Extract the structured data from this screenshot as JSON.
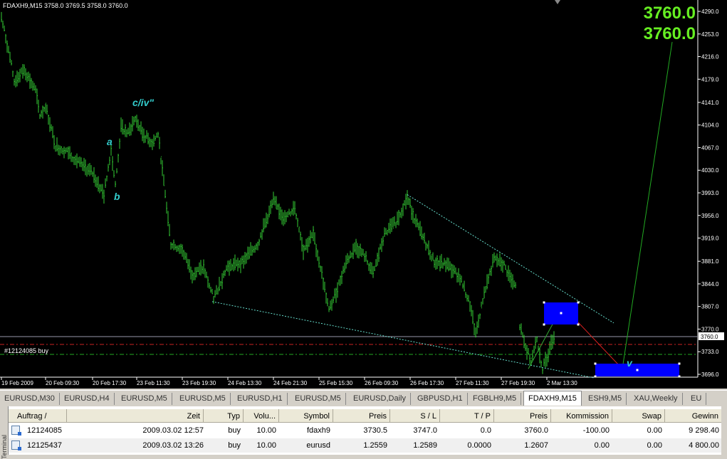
{
  "chart": {
    "title": "FDAXH9,M15  3758.0 3769.5 3758.0 3760.0",
    "big_price_1": "3760.0",
    "big_price_2": "3760.0",
    "current_price_label": "3760.0",
    "order_label": "#12124085 buy",
    "wave_labels": [
      "c/iv\"",
      "a",
      "b",
      "v"
    ],
    "price_axis": [
      "4290.0",
      "4253.0",
      "4216.0",
      "4179.0",
      "4141.0",
      "4104.0",
      "4067.0",
      "4030.0",
      "3993.0",
      "3956.0",
      "3919.0",
      "3881.0",
      "3844.0",
      "3807.0",
      "3770.0",
      "3733.0",
      "3696.0"
    ],
    "time_axis": [
      "19 Feb 2009",
      "20 Feb 09:30",
      "20 Feb 17:30",
      "23 Feb 11:30",
      "23 Feb 19:30",
      "24 Feb 13:30",
      "24 Feb 21:30",
      "25 Feb 15:30",
      "26 Feb 09:30",
      "26 Feb 17:30",
      "27 Feb 11:30",
      "27 Feb 19:30",
      "2 Mar 13:30"
    ],
    "colors": {
      "bars": "#33cc33",
      "label": "#33cccc",
      "big_price": "#66ee22",
      "rect": "#0000ff"
    }
  },
  "tabs": [
    "EURUSD,M30",
    "EURUSD,H4",
    "EURUSD,M5",
    "EURUSD,M5",
    "EURUSD,H1",
    "EURUSD,M5",
    "EURUSD,Daily",
    "GBPUSD,H1",
    "FGBLH9,M5",
    "FDAXH9,M15",
    "ESH9,M5",
    "XAU,Weekly",
    "EU"
  ],
  "active_tab": "FDAXH9,M15",
  "terminal": {
    "side_label": "Terminal",
    "columns": [
      "Auftrag  /",
      "Zeit",
      "Typ",
      "Volu...",
      "Symbol",
      "Preis",
      "S / L",
      "T / P",
      "Preis",
      "Kommission",
      "Swap",
      "Gewinn"
    ],
    "rows": [
      {
        "auftrag": "12124085",
        "zeit": "2009.03.02 12:57",
        "typ": "buy",
        "volu": "10.00",
        "symbol": "fdaxh9",
        "preis": "3730.5",
        "sl": "3747.0",
        "tp": "0.0",
        "preis2": "3760.0",
        "kommission": "-100.00",
        "swap": "0.00",
        "gewinn": "9 298.40"
      },
      {
        "auftrag": "12125437",
        "zeit": "2009.03.02 13:26",
        "typ": "buy",
        "volu": "10.00",
        "symbol": "eurusd",
        "preis": "1.2559",
        "sl": "1.2589",
        "tp": "0.0000",
        "preis2": "1.2607",
        "kommission": "0.00",
        "swap": "0.00",
        "gewinn": "4 800.00"
      }
    ]
  }
}
